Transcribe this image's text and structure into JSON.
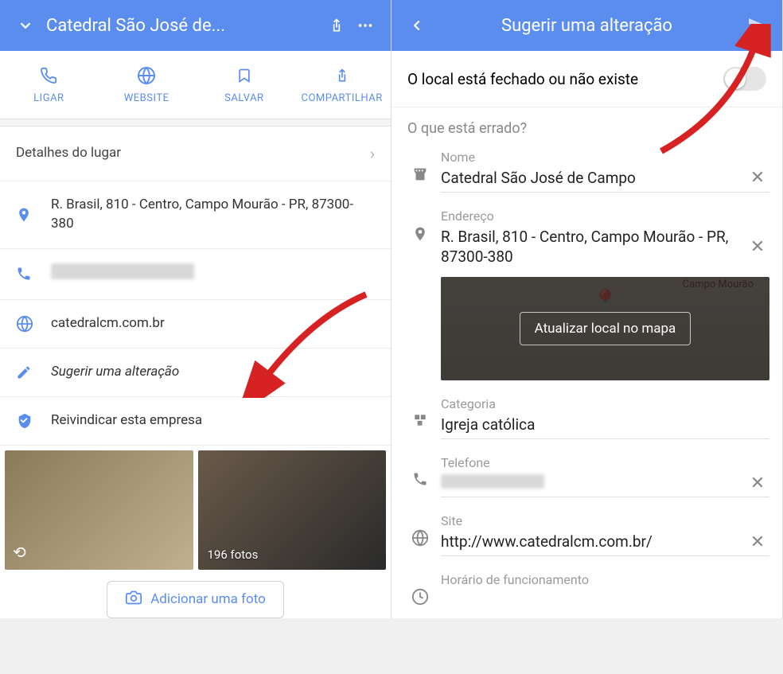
{
  "left": {
    "header_title": "Catedral São José de...",
    "actions": {
      "call": "LIGAR",
      "website": "WEBSITE",
      "save": "SALVAR",
      "share": "COMPARTILHAR"
    },
    "details_header": "Detalhes do lugar",
    "address": "R. Brasil, 810 - Centro, Campo Mourão - PR, 87300-380",
    "website_value": "catedralcm.com.br",
    "suggest_edit": "Sugerir uma alteração",
    "claim_business": "Reivindicar esta empresa",
    "photo_count": "196 fotos",
    "add_photo": "Adicionar uma foto"
  },
  "right": {
    "header_title": "Sugerir uma alteração",
    "closed_toggle_label": "O local está fechado ou não existe",
    "whats_wrong": "O que está errado?",
    "fields": {
      "name_label": "Nome",
      "name_value": "Catedral São José de Campo",
      "address_label": "Endereço",
      "address_value": "R. Brasil, 810 - Centro, Campo Mourão - PR, 87300-380",
      "map_update": "Atualizar local no mapa",
      "map_toptext": "Campo Mourão",
      "category_label": "Categoria",
      "category_value": "Igreja católica",
      "phone_label": "Telefone",
      "site_label": "Site",
      "site_value": "http://www.catedralcm.com.br/",
      "hours_label": "Horário de funcionamento"
    }
  }
}
